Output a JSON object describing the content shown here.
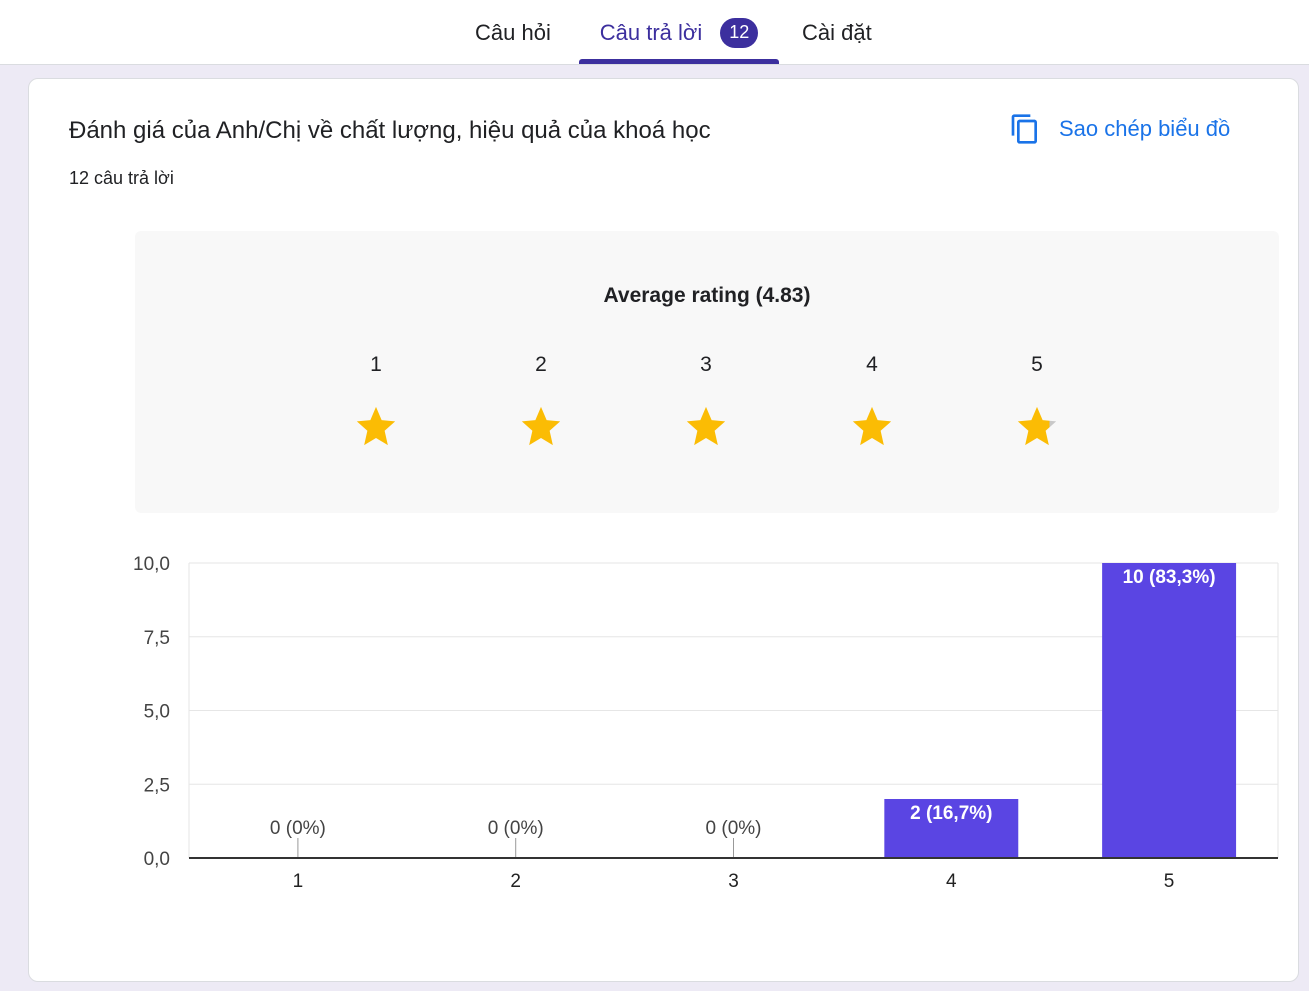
{
  "tabs": {
    "questions": "Câu hỏi",
    "responses": "Câu trả lời",
    "responses_count": "12",
    "settings": "Cài đặt"
  },
  "question": {
    "title": "Đánh giá của Anh/Chị về chất lượng, hiệu quả của khoá học",
    "response_count_text": "12 câu trả lời",
    "copy_chart_label": "Sao chép biểu đồ"
  },
  "rating": {
    "average_label": "Average rating (4.83)",
    "average_value": 4.83,
    "scale": [
      "1",
      "2",
      "3",
      "4",
      "5"
    ],
    "star_color": "#fbbc04",
    "star_empty_color": "#c8c8c8"
  },
  "chart_data": {
    "type": "bar",
    "categories": [
      "1",
      "2",
      "3",
      "4",
      "5"
    ],
    "values": [
      0,
      0,
      0,
      2,
      10
    ],
    "data_labels": [
      "0 (0%)",
      "0 (0%)",
      "0 (0%)",
      "2 (16,7%)",
      "10 (83,3%)"
    ],
    "yticks": [
      "0,0",
      "2,5",
      "5,0",
      "7,5",
      "10,0"
    ],
    "ylim": [
      0,
      10
    ],
    "grid": true,
    "bar_color": "#5a45e3"
  },
  "colors": {
    "accent": "#3c2f9e",
    "link": "#1a73e8",
    "bar": "#5a45e3"
  }
}
